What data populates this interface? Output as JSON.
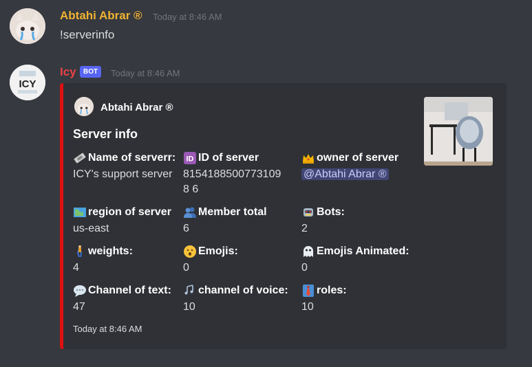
{
  "messages": [
    {
      "author": "Abtahi Abrar ®",
      "timestamp": "Today at 8:46 AM",
      "text": "!serverinfo"
    },
    {
      "author": "Icy",
      "bot_tag": "BOT",
      "timestamp": "Today at 8:46 AM",
      "avatar_text": "ICY"
    }
  ],
  "embed": {
    "author": "Abtahi Abrar ®",
    "title": "Server info",
    "border_color": "#e01010",
    "fields": [
      {
        "icon": "ticket-icon",
        "name": "Name of serverr:",
        "value": "ICY's support server"
      },
      {
        "icon": "id-icon",
        "name": "ID of server",
        "value": "81541885007731098 6"
      },
      {
        "icon": "crown-icon",
        "name": "owner of server",
        "value": "@Abtahi Abrar ®"
      },
      {
        "icon": "map-icon",
        "name": "region of server",
        "value": "us-east"
      },
      {
        "icon": "members-icon",
        "name": "Member total",
        "value": "6"
      },
      {
        "icon": "robot-icon",
        "name": "Bots:",
        "value": "2"
      },
      {
        "icon": "walking-icon",
        "name": "weights:",
        "value": "4"
      },
      {
        "icon": "hushed-face-icon",
        "name": "Emojis:",
        "value": "0"
      },
      {
        "icon": "ghost-icon",
        "name": "Emojis Animated:",
        "value": "0"
      },
      {
        "icon": "speech-bubble-icon",
        "name": "Channel of text:",
        "value": "47"
      },
      {
        "icon": "music-notes-icon",
        "name": "channel of voice:",
        "value": "10"
      },
      {
        "icon": "necktie-icon",
        "name": "roles:",
        "value": "10"
      }
    ],
    "footer": "Today at 8:46 AM"
  }
}
